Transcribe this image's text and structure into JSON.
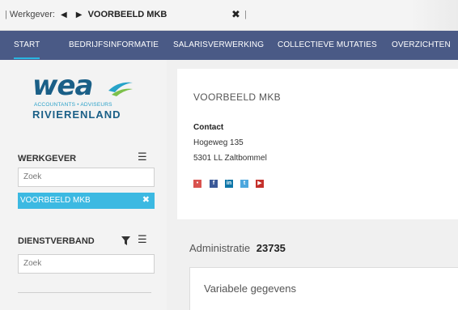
{
  "topbar": {
    "separator": "|",
    "label": "Werkgever:",
    "prev_icon": "prev-arrow-icon",
    "next_icon": "next-arrow-icon",
    "employer": "VOORBEELD MKB",
    "close": "✖",
    "separator_end": "|"
  },
  "nav": {
    "items": [
      "START",
      "BEDRIJFSINFORMATIE",
      "SALARISVERWERKING",
      "COLLECTIEVE MUTATIES",
      "OVERZICHTEN"
    ],
    "active_index": 0,
    "active_color": "#29b6e2",
    "background": "#4a5a86"
  },
  "logo": {
    "mark": "wea",
    "subtitle": "ACCOUNTANTS • ADVISEURS",
    "brand": "RIVIERENLAND"
  },
  "sidebar": {
    "werkgever": {
      "title": "WERKGEVER",
      "list_icon": "list-icon",
      "search_placeholder": "Zoek",
      "selected": "VOORBEELD MKB",
      "remove": "✖"
    },
    "dienstverband": {
      "title": "DIENSTVERBAND",
      "filter_icon": "filter-icon",
      "list_icon": "list-icon",
      "search_placeholder": "Zoek"
    }
  },
  "company": {
    "name": "VOORBEELD MKB",
    "contact_label": "Contact",
    "address_line1": "Hogeweg 135",
    "address_line2": "5301 LL Zaltbommel",
    "social": [
      {
        "icon": "map-pin-icon",
        "color": "#d9534f"
      },
      {
        "icon": "facebook-icon",
        "color": "#3b5998"
      },
      {
        "icon": "linkedin-icon",
        "color": "#0e76a8"
      },
      {
        "icon": "twitter-icon",
        "color": "#4da7de"
      },
      {
        "icon": "youtube-icon",
        "color": "#c4302b"
      }
    ]
  },
  "administratie": {
    "label": "Administratie",
    "number": "23735"
  },
  "variabele": {
    "title": "Variabele gegevens"
  }
}
